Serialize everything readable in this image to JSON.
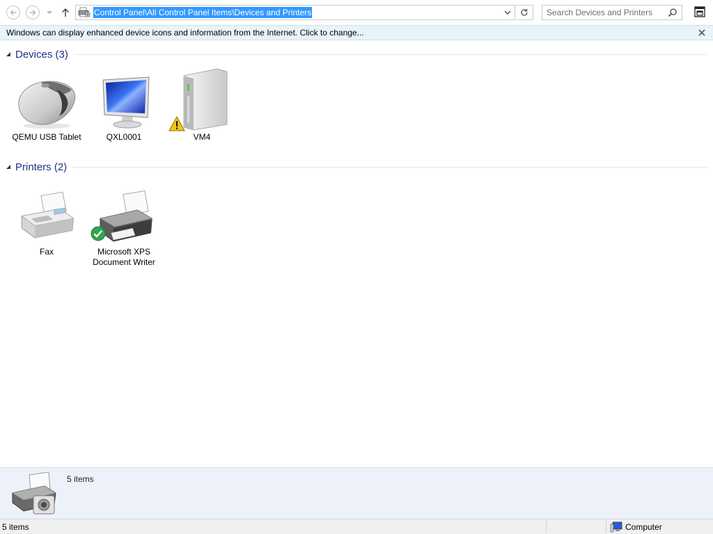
{
  "navbar": {
    "address_path": "Control Panel\\All Control Panel Items\\Devices and Printers",
    "search_placeholder": "Search Devices and Printers"
  },
  "infobar": {
    "message": "Windows can display enhanced device icons and information from the Internet. Click to change..."
  },
  "groups": {
    "devices": {
      "title": "Devices (3)",
      "items": [
        {
          "label": "QEMU USB Tablet",
          "icon": "mouse-icon"
        },
        {
          "label": "QXL0001",
          "icon": "monitor-icon"
        },
        {
          "label": "VM4",
          "icon": "computer-tower-icon",
          "badge": "warning-icon"
        }
      ]
    },
    "printers": {
      "title": "Printers (2)",
      "items": [
        {
          "label": "Fax",
          "icon": "fax-icon"
        },
        {
          "label": "Microsoft XPS Document Writer",
          "icon": "printer-icon",
          "badge": "default-check-icon"
        }
      ]
    }
  },
  "details": {
    "count": "5 items"
  },
  "statusbar": {
    "items_count": "5 items",
    "location": "Computer"
  },
  "colors": {
    "accent": "#3399ff",
    "group_title": "#1e3287",
    "infobar_bg": "#e8f3fa",
    "details_bg": "#edf2fa"
  }
}
